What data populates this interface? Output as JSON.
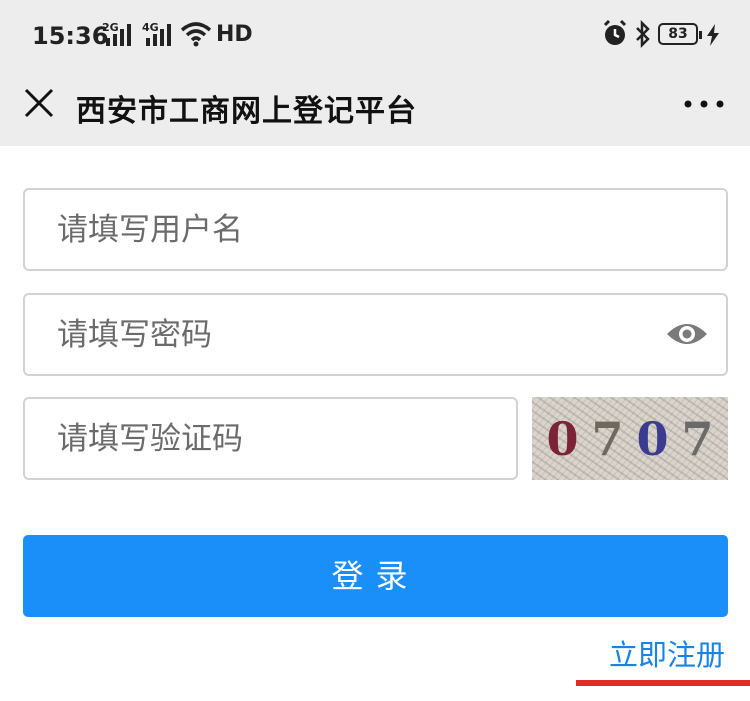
{
  "status_bar": {
    "time": "15:36",
    "network_1": "2G",
    "network_2": "4G",
    "hd_label": "HD",
    "battery": "83",
    "icons": [
      "signal-icon",
      "wifi-icon",
      "alarm-icon",
      "bluetooth-icon",
      "battery-icon",
      "charging-icon"
    ]
  },
  "navbar": {
    "title": "西安市工商网上登记平台",
    "close_icon": "close-icon",
    "more_icon": "more-icon"
  },
  "form": {
    "username_placeholder": "请填写用户名",
    "username_value": "",
    "password_placeholder": "请填写密码",
    "password_value": "",
    "captcha_placeholder": "请填写验证码",
    "captcha_value": "",
    "captcha_digits": [
      "0",
      "7",
      "0",
      "7"
    ],
    "login_label": "登录",
    "register_label": "立即注册"
  },
  "colors": {
    "accent": "#1a8ffa",
    "link": "#1a84e6",
    "annotation": "#e02b2b"
  }
}
